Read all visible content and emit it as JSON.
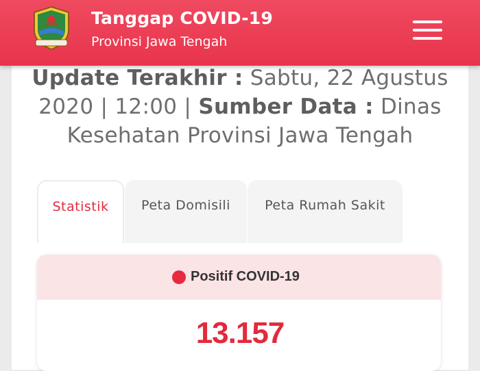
{
  "header": {
    "title": "Tanggap COVID-19",
    "subtitle": "Provinsi Jawa Tengah",
    "logo_icon": "central-java-emblem-icon",
    "menu_icon": "hamburger-menu-icon",
    "color": "#e8344c"
  },
  "update": {
    "label": "Update Terakhir :",
    "datetime": "Sabtu, 22 Agustus 2020 | 12:00",
    "separator": "|",
    "source_label": "Sumber Data :",
    "source": "Dinas Kesehatan Provinsi Jawa Tengah"
  },
  "tabs": [
    {
      "label": "Statistik",
      "active": true
    },
    {
      "label": "Peta Domisili",
      "active": false
    },
    {
      "label": "Peta Rumah Sakit",
      "active": false
    }
  ],
  "stat_card": {
    "label": "Positif COVID-19",
    "value": "13.157",
    "dot_color": "#e8293f"
  }
}
